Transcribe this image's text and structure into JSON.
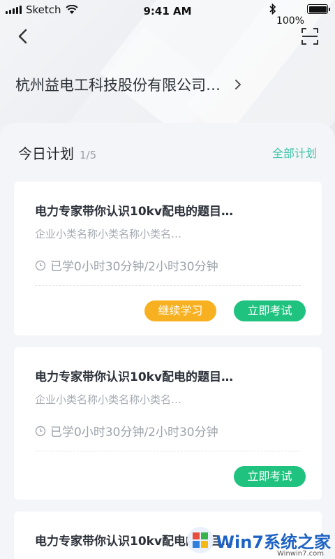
{
  "status_bar": {
    "carrier": "Sketch",
    "time": "9:41 AM",
    "battery_percent": "100%",
    "battery_level": 1.0
  },
  "nav": {
    "back_icon": "chevron-left-icon",
    "scan_icon": "scan-icon"
  },
  "company": {
    "name": "杭州益电工科技股份有限公司…",
    "chevron_icon": "chevron-right-icon"
  },
  "plan": {
    "title": "今日计划",
    "count": "1/5",
    "all_link": "全部计划"
  },
  "cards": [
    {
      "title": "电力专家带你认识10kv配电的题目…",
      "subtitle": "企业小类名称小类名称小类名…",
      "time": "已学0小时30分钟/2小时30分钟",
      "continue_label": "继续学习",
      "exam_label": "立即考试"
    },
    {
      "title": "电力专家带你认识10kv配电的题目…",
      "subtitle": "企业小类名称小类名称小类名…",
      "time": "已学0小时30分钟/2小时30分钟",
      "exam_label": "立即考试"
    },
    {
      "title": "电力专家带你认识10kv配电的题目…"
    }
  ],
  "watermark": {
    "text": "Win7系统之家",
    "url_text": "Winwin7.com"
  },
  "colors": {
    "accent_link": "#3cc3a8",
    "continue_button": "#f7b120",
    "exam_button": "#1fc27e"
  }
}
